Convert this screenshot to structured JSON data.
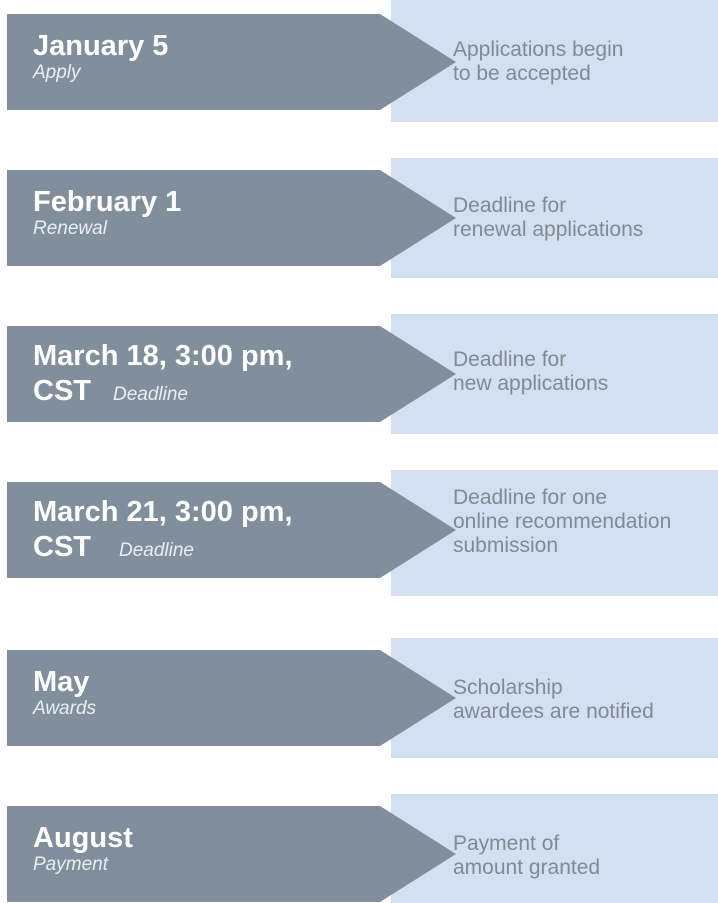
{
  "items": [
    {
      "date": "January 5",
      "label": "Apply",
      "description": "Applications begin\nto be accepted"
    },
    {
      "date": "February 1",
      "label": "Renewal",
      "description": "Deadline for\nrenewal applications"
    },
    {
      "date_line1": "March 18, 3:00 pm,",
      "date_line2": "CST",
      "label": "Deadline",
      "description": "Deadline for\nnew applications"
    },
    {
      "date_line1": "March 21, 3:00 pm,",
      "date_line2": "CST",
      "label": "Deadline",
      "description": "Deadline for one\nonline recommendation\nsubmission"
    },
    {
      "date": "May",
      "label": "Awards",
      "description": "Scholarship\nawardees are notified"
    },
    {
      "date": "August",
      "label": "Payment",
      "description": "Payment of\namount granted"
    }
  ],
  "colors": {
    "arrow": "#808f9b",
    "panel": "#d3e0f2",
    "panel_text": "#808a91",
    "arrow_text": "#ffffff"
  }
}
